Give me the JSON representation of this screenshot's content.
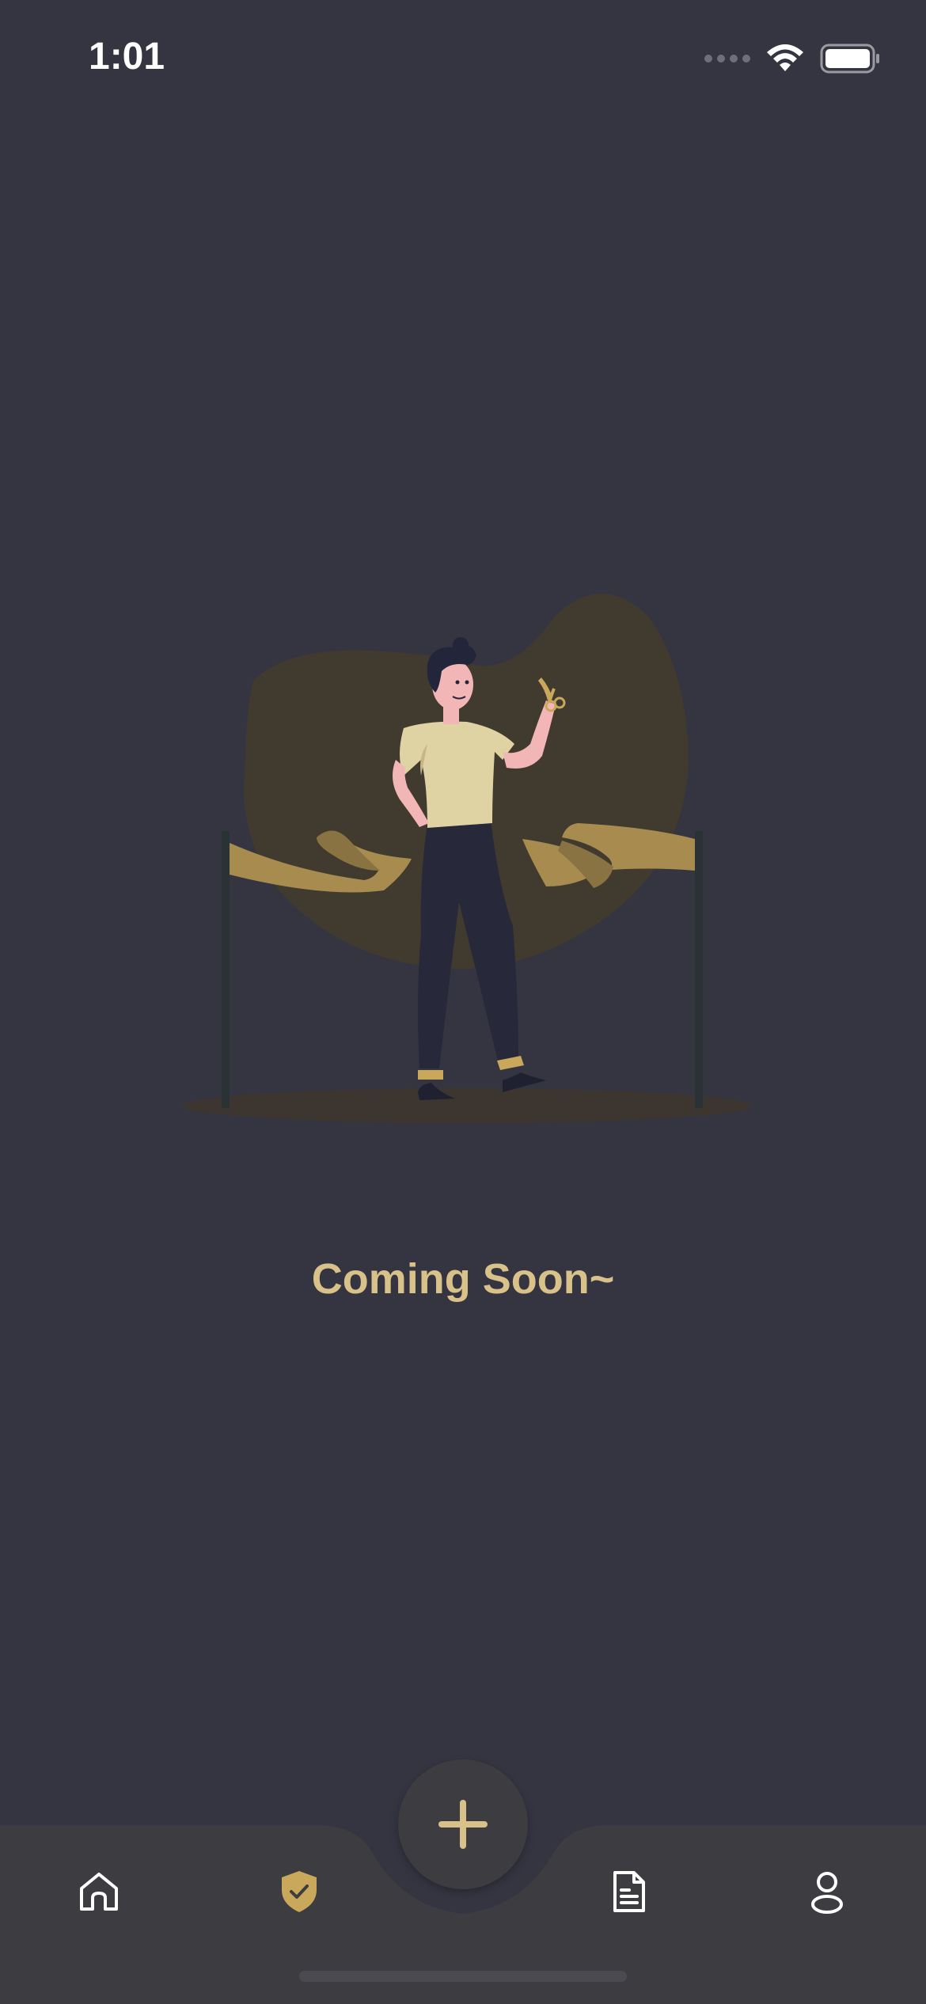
{
  "status_bar": {
    "time": "1:01"
  },
  "main": {
    "message": "Coming Soon~"
  },
  "tab_bar": {
    "tabs": [
      {
        "id": "home",
        "icon": "home-icon",
        "active": false
      },
      {
        "id": "shield",
        "icon": "shield-check-icon",
        "active": true
      },
      {
        "id": "documents",
        "icon": "document-icon",
        "active": false
      },
      {
        "id": "profile",
        "icon": "user-icon",
        "active": false
      }
    ],
    "center_button_icon": "plus-icon"
  },
  "colors": {
    "background": "#343541",
    "accent": "#d9c18a",
    "tab_bar": "#3c3c41",
    "icon_inactive": "#ffffff",
    "icon_active": "#c9a85c"
  }
}
